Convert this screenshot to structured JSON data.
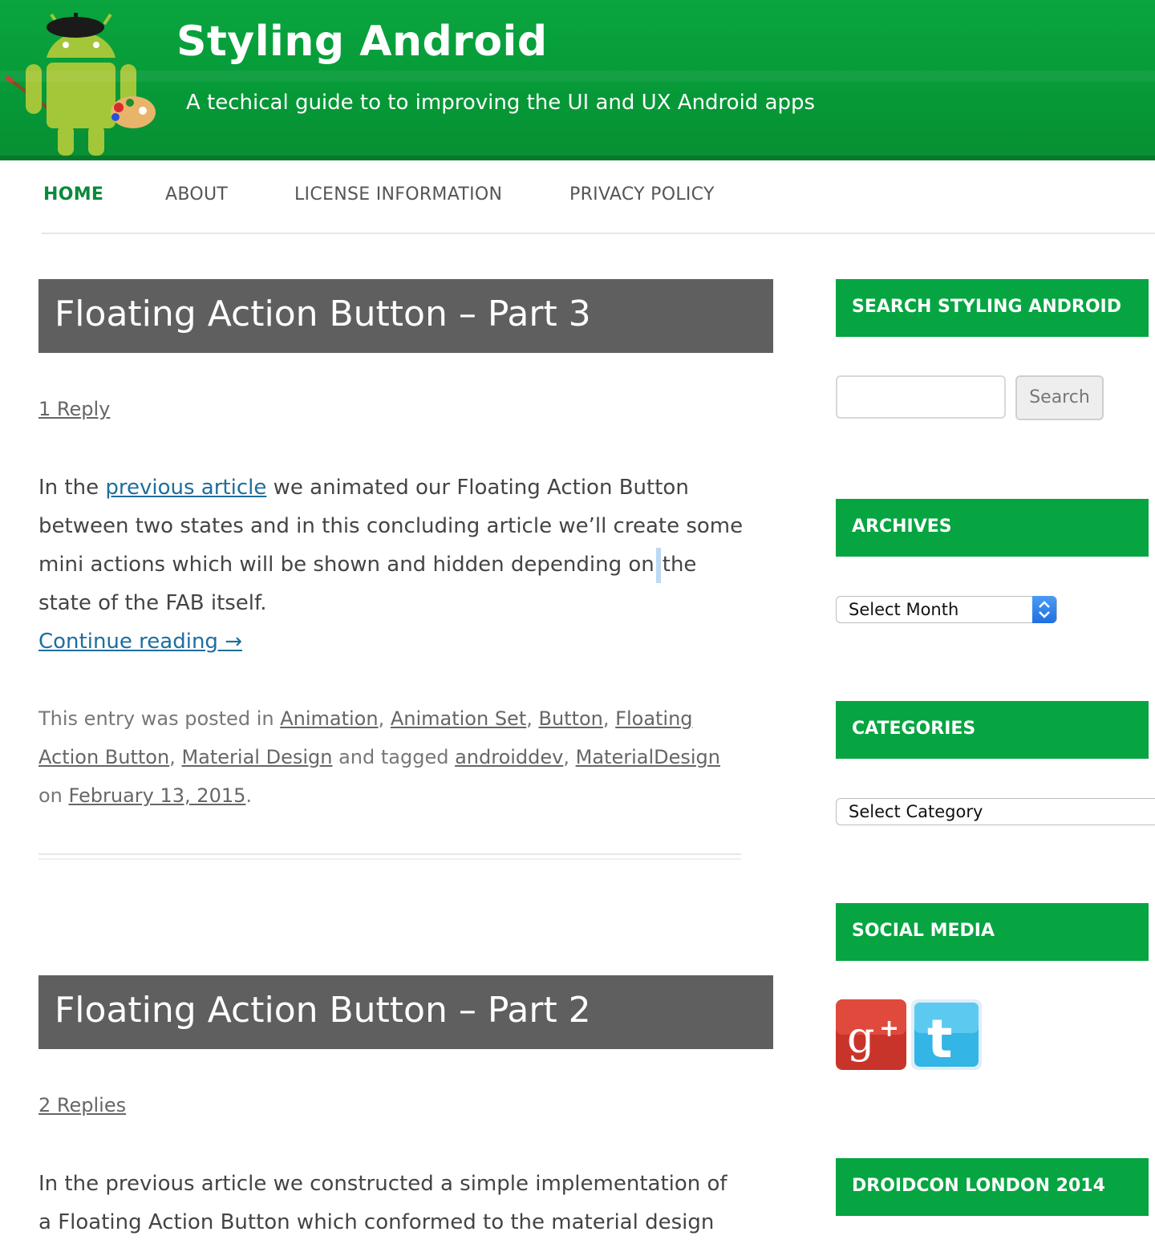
{
  "site": {
    "title": "Styling Android",
    "tagline": "A techical guide to to improving the UI and UX Android apps"
  },
  "nav": {
    "items": [
      "HOME",
      "ABOUT",
      "LICENSE INFORMATION",
      "PRIVACY POLICY"
    ],
    "active": "HOME"
  },
  "posts": [
    {
      "title": "Floating Action Button – Part 3",
      "replies": "1 Reply",
      "excerpt": {
        "before_link": "In the ",
        "link": "previous article",
        "text_a": " we animated our Floating Action Button between two states and in this concluding article we’ll create some mini actions which will be shown and hidden depending on",
        "text_b": "the state of the FAB itself."
      },
      "continue": "Continue reading →",
      "meta": {
        "prefix": "This entry was posted in ",
        "categories": [
          "Animation",
          "Animation Set",
          "Button",
          "Floating Action Button",
          "Material Design"
        ],
        "tagged_label": " and tagged ",
        "tags": [
          "androiddev",
          "MaterialDesign"
        ],
        "on_label": "on ",
        "date": "February 13, 2015"
      }
    },
    {
      "title": "Floating Action Button – Part 2",
      "replies": "2 Replies",
      "excerpt": {
        "text": "In the previous article we constructed a simple implementation of a Floating Action Button which conformed to the material design"
      }
    }
  ],
  "sidebar": {
    "search": {
      "title": "SEARCH STYLING ANDROID",
      "placeholder": "",
      "button": "Search"
    },
    "archives": {
      "title": "ARCHIVES",
      "select": "Select Month"
    },
    "categories": {
      "title": "CATEGORIES",
      "select": "Select Category"
    },
    "social": {
      "title": "SOCIAL MEDIA",
      "icons": [
        "google-plus-icon",
        "twitter-icon"
      ]
    },
    "droidcon": {
      "title": "DROIDCON LONDON 2014"
    }
  },
  "colors": {
    "header_green": "#069a38",
    "widget_green": "#06a542",
    "title_bar_gray": "#5f5f5f",
    "link_blue": "#1e6e9e",
    "active_nav": "#0a8a3a"
  }
}
